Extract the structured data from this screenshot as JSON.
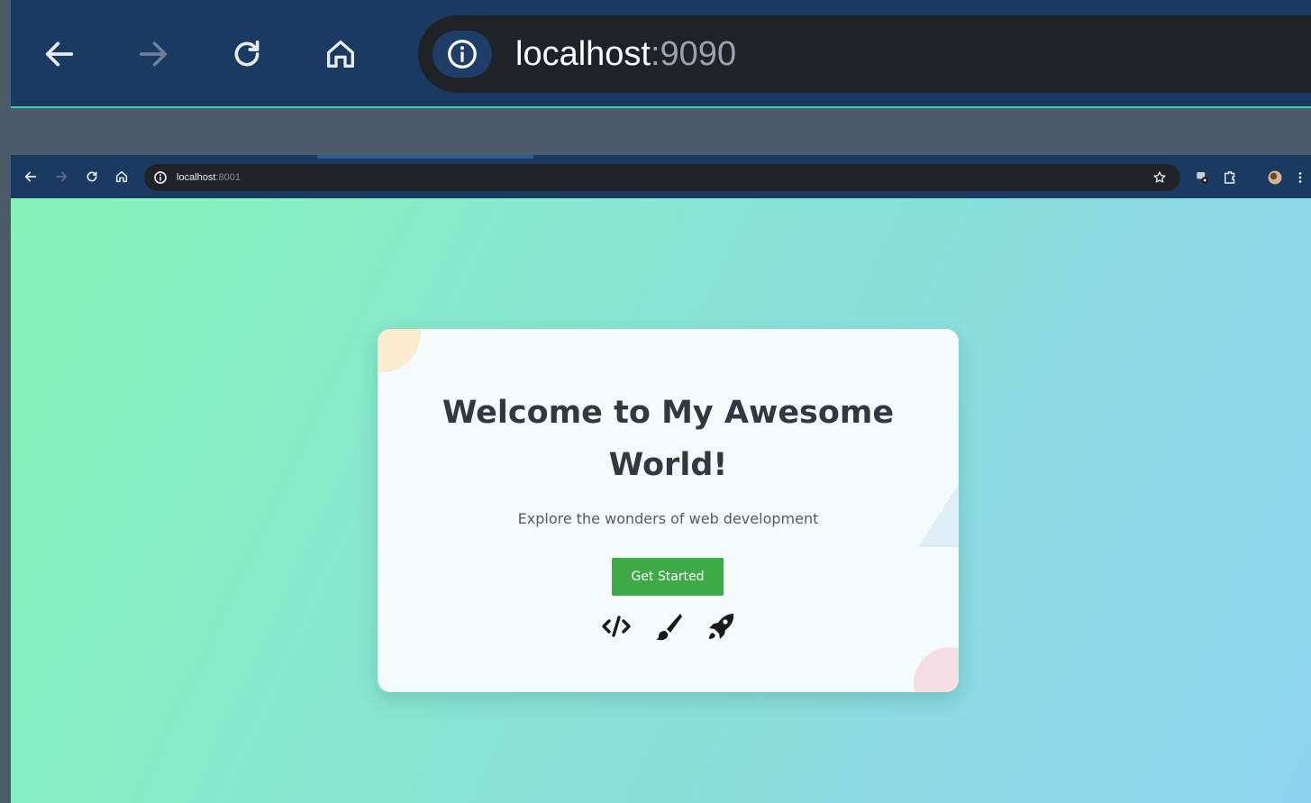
{
  "outer_browser": {
    "url_host": "localhost",
    "url_port": ":9090"
  },
  "inner_browser": {
    "url_host": "localhost",
    "url_port": ":8001"
  },
  "page": {
    "title": "Welcome to My Awesome World!",
    "subtitle": "Explore the wonders of web development",
    "button_label": "Get Started",
    "icons": [
      "code-icon",
      "paintbrush-icon",
      "rocket-icon"
    ]
  },
  "colors": {
    "toolbar": "#1a3a61",
    "accent_line": "#3fd3a3",
    "button": "#3faa48",
    "gradient_start": "#86f3b6",
    "gradient_end": "#8cd4ee"
  }
}
